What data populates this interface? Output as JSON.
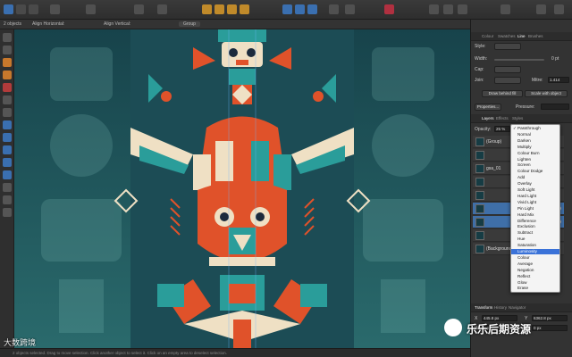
{
  "context_bar": {
    "selection": "2 objects",
    "align_horizontal": "Align Horizontal:",
    "align_vertical": "Align Vertical:",
    "group": "Group"
  },
  "status_bar": {
    "text": "2 objects selected. Drag to move selection. Click another object to select it. Click on an empty area to deselect selection."
  },
  "panel": {
    "top_tabs": [
      "Colour",
      "Swatches",
      "Line",
      "Brushes"
    ],
    "active_top_tab": "Line",
    "style_label": "Style:",
    "width_label": "Width:",
    "width_value": "0 pt",
    "cap_label": "Cap:",
    "join_label": "Join:",
    "mitre_label": "Mitre:",
    "mitre_value": "1.414",
    "draw_behind_fill": "Draw behind fill",
    "scale_with_object": "Scale with object",
    "properties_button": "Properties...",
    "pressure_label": "Pressure:",
    "layer_tabs": [
      "Layers",
      "Effects",
      "Styles"
    ],
    "active_layer_tab": "Layers",
    "opacity_label": "Opacity:",
    "opacity_value": "25 %",
    "layers": [
      {
        "name": "(Group)",
        "selected": false
      },
      {
        "name": "",
        "selected": false
      },
      {
        "name": "gsa_01",
        "selected": false
      },
      {
        "name": "",
        "selected": false
      },
      {
        "name": "",
        "selected": false
      },
      {
        "name": "",
        "selected": true
      },
      {
        "name": "",
        "selected": true
      },
      {
        "name": "",
        "selected": false
      },
      {
        "name": "(Background)",
        "selected": false
      }
    ],
    "bottom_tabs": [
      "Transform",
      "History",
      "Navigator"
    ],
    "transform_x": "445.8 px",
    "transform_y": "6362.8 px",
    "transform_w": "0 px",
    "transform_h": "0 px"
  },
  "blend_menu": {
    "checked": "Passthrough",
    "highlighted": "Luminosity",
    "items": [
      "Passthrough",
      "Normal",
      "Darken",
      "Multiply",
      "Colour Burn",
      "Lighten",
      "Screen",
      "Colour Dodge",
      "Add",
      "Overlay",
      "Soft Light",
      "Hard Light",
      "Vivid Light",
      "Pin Light",
      "Hard Mix",
      "Difference",
      "Exclusion",
      "Subtract",
      "Hue",
      "Saturation",
      "Luminosity",
      "Colour",
      "Average",
      "Negation",
      "Reflect",
      "Glow",
      "Erase"
    ]
  },
  "watermarks": {
    "left": "大数跨境",
    "right": "乐乐后期资源"
  },
  "colors": {
    "teal_dark": "#1d4a52",
    "teal": "#2a9d9a",
    "orange": "#e0522a",
    "cream": "#efe0c4",
    "navy": "#1b2a3c",
    "accent_blue": "#3a72d8"
  }
}
